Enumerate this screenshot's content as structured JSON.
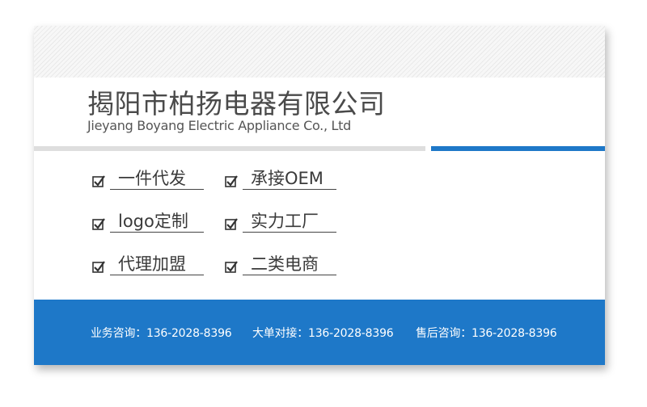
{
  "company": {
    "name_cn": "揭阳市柏扬电器有限公司",
    "name_en": "Jieyang Boyang Electric Appliance Co., Ltd"
  },
  "features": [
    {
      "label": "一件代发"
    },
    {
      "label": "承接OEM"
    },
    {
      "label": "logo定制"
    },
    {
      "label": "实力工厂"
    },
    {
      "label": "代理加盟"
    },
    {
      "label": "二类电商"
    }
  ],
  "contacts": [
    {
      "label": "业务咨询：",
      "phone": "136-2028-8396"
    },
    {
      "label": "大单对接：",
      "phone": "136-2028-8396"
    },
    {
      "label": "售后咨询：",
      "phone": "136-2028-8396"
    }
  ],
  "colors": {
    "accent": "#1e78c8",
    "text": "#4a4a4a",
    "divider": "#dedede"
  },
  "icons": {
    "check": "checkbox-checked-icon"
  }
}
